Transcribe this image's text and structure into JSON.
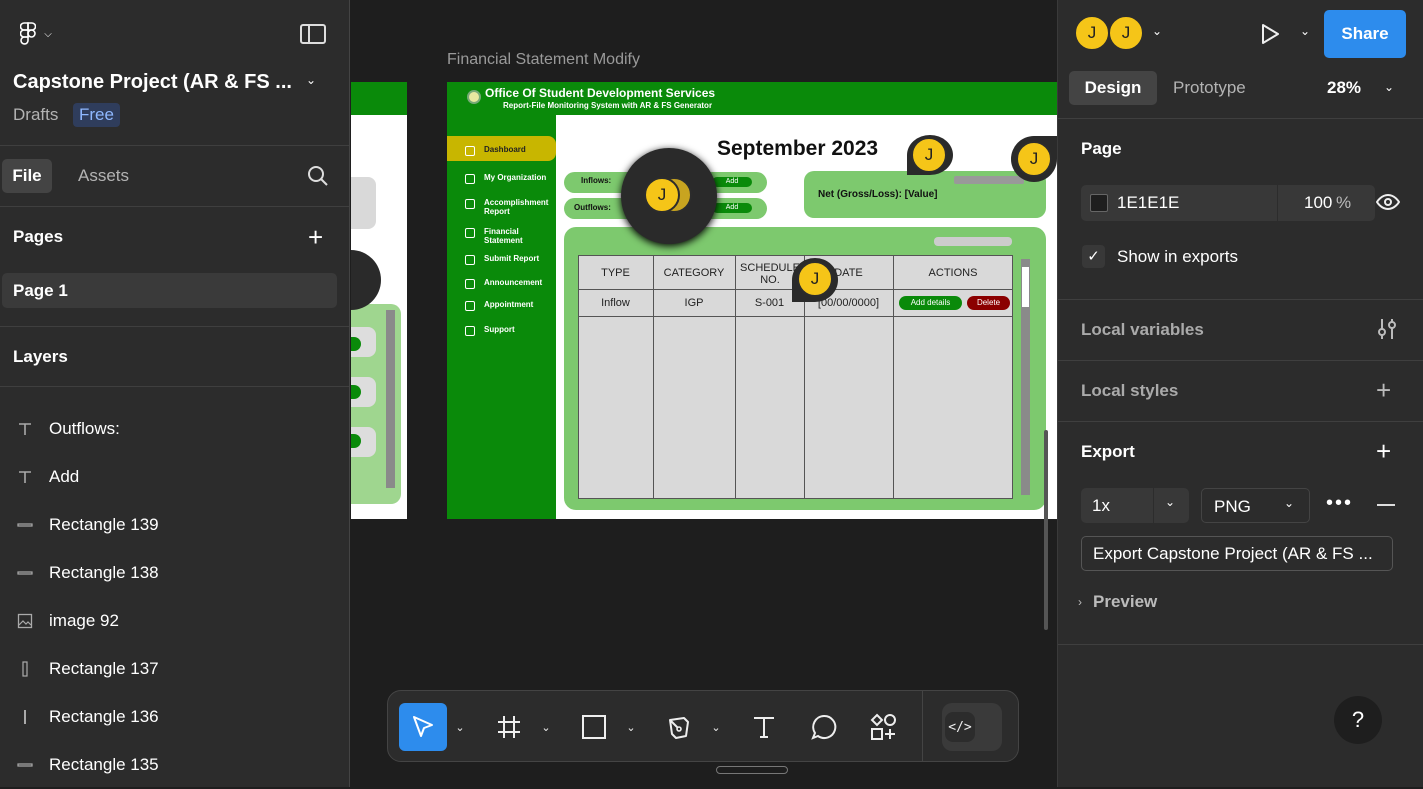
{
  "file": {
    "title": "Capstone Project (AR & FS ...",
    "drafts": "Drafts",
    "plan": "Free"
  },
  "left_tabs": {
    "file": "File",
    "assets": "Assets"
  },
  "pages": {
    "heading": "Pages",
    "items": [
      "Page 1"
    ]
  },
  "layers": {
    "heading": "Layers",
    "items": [
      {
        "icon": "text-icon",
        "label": "Outflows:"
      },
      {
        "icon": "text-icon",
        "label": "Add"
      },
      {
        "icon": "line-icon",
        "label": "Rectangle 139"
      },
      {
        "icon": "line-icon",
        "label": "Rectangle 138"
      },
      {
        "icon": "image-icon",
        "label": "image 92"
      },
      {
        "icon": "rect-icon",
        "label": "Rectangle 137"
      },
      {
        "icon": "vline-icon",
        "label": "Rectangle 136"
      },
      {
        "icon": "line-icon",
        "label": "Rectangle 135"
      }
    ]
  },
  "canvas": {
    "frame_label": "Financial Statement Modify",
    "frame": {
      "header_title": "Office Of Student Development Services",
      "header_sub": "Report-File Monitoring System with AR & FS Generator",
      "nav": [
        "Dashboard",
        "My Organization",
        "Accomplishment Report",
        "Financial Statement",
        "Submit Report",
        "Announcement",
        "Appointment",
        "Support"
      ],
      "month": "September 2023",
      "inflows": "Inflows:",
      "outflows": "Outflows:",
      "add": "Add",
      "net": "Net (Gross/Loss):  [Value]",
      "columns": [
        "TYPE",
        "CATEGORY",
        "SCHEDULE NO.",
        "DATE",
        "ACTIONS"
      ],
      "row": [
        "Inflow",
        "IGP",
        "S-001",
        "[00/00/0000]"
      ],
      "add_details": "Add details",
      "delete": "Delete"
    },
    "avatar_letter": "J"
  },
  "right": {
    "avatars": [
      "J",
      "J"
    ],
    "share": "Share",
    "tabs": {
      "design": "Design",
      "prototype": "Prototype"
    },
    "zoom": "28%",
    "page": {
      "heading": "Page",
      "color": "1E1E1E",
      "opacity": "100",
      "pct": "%",
      "show_exports": "Show in exports"
    },
    "local_variables": "Local variables",
    "local_styles": "Local styles",
    "export": {
      "heading": "Export",
      "scale": "1x",
      "format": "PNG",
      "button": "Export Capstone Project (AR & FS ...",
      "preview": "Preview"
    },
    "help": "?"
  },
  "colors": {
    "accent": "#2d8ced",
    "green": "#0a8a0a",
    "light_green": "#7dc96e",
    "avatar": "#f5c518",
    "canvas": "#1e1e1e"
  }
}
